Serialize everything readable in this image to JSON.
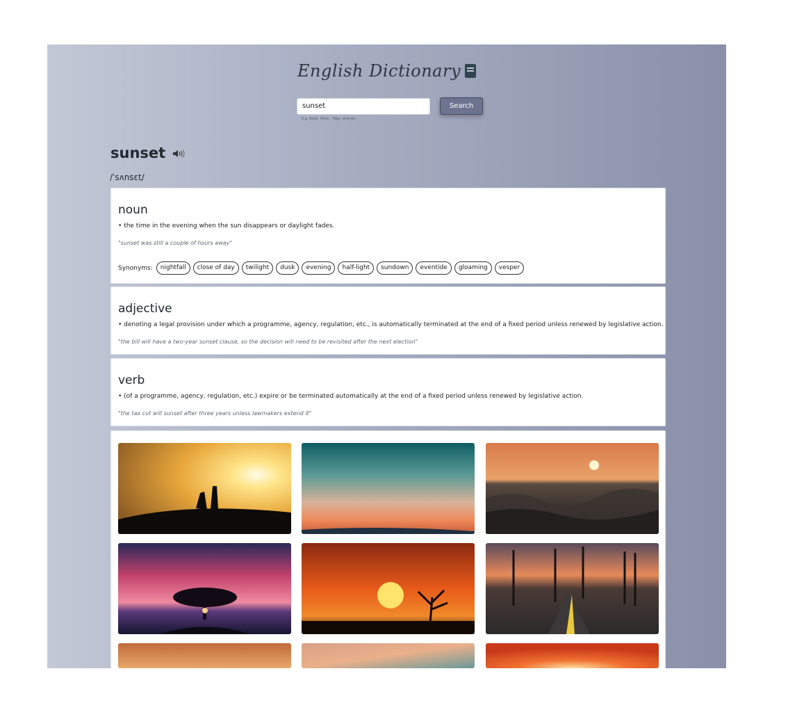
{
  "app": {
    "title": "English Dictionary",
    "title_icon": "book-icon"
  },
  "search": {
    "value": "sunset",
    "button_label": "Search",
    "hint": "E.g. Book, Wine , Yoga ,and etc."
  },
  "entry": {
    "word": "sunset",
    "phonetic": "/ˈsʌnsɛt/",
    "audio_icon": "speaker-icon",
    "meanings": [
      {
        "part_of_speech": "noun",
        "definition": "• the time in the evening when the sun disappears or daylight fades.",
        "example": "\"sunset was still a couple of hours away\"",
        "synonyms_label": "Synonyms:",
        "synonyms": [
          "nightfall",
          "close of day",
          "twilight",
          "dusk",
          "evening",
          "half-light",
          "sundown",
          "eventide",
          "gloaming",
          "vesper"
        ]
      },
      {
        "part_of_speech": "adjective",
        "definition": "• denoting a legal provision under which a programme, agency, regulation, etc., is automatically terminated at the end of a fixed period unless renewed by legislative action.",
        "example": "\"the bill will have a two-year sunset clause, so the decision will need to be revisited after the next election\""
      },
      {
        "part_of_speech": "verb",
        "definition": "• (of a programme, agency, regulation, etc.) expire or be terminated automatically at the end of a fixed period unless renewed by legislative action.",
        "example": "\"the tax cut will sunset after three years unless lawmakers extend it\""
      }
    ]
  },
  "colors": {
    "accent_button": "#6d7490",
    "text_dark": "#202a30",
    "example_text": "#5f6670"
  }
}
